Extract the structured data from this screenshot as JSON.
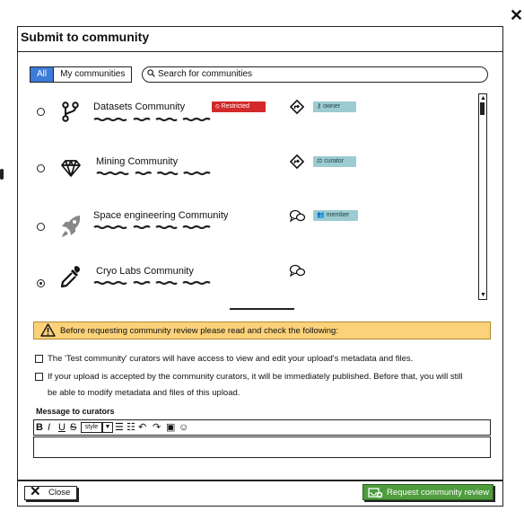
{
  "modal": {
    "title": "Submit to community",
    "close_glyph": "✕"
  },
  "filter": {
    "tabs": [
      {
        "label": "All",
        "active": true
      },
      {
        "label": "My communities",
        "active": false
      }
    ],
    "search_placeholder": "Search for communities"
  },
  "communities": [
    {
      "name": "Datasets Community",
      "logo": "git-branch-icon",
      "selected": false,
      "badge": "Restricted",
      "action_icon": "direction-sign-icon",
      "role": "owner",
      "role_icon": "key-icon"
    },
    {
      "name": "Mining Community",
      "logo": "diamond-icon",
      "selected": false,
      "badge": "",
      "action_icon": "direction-sign-icon",
      "role": "curator",
      "role_icon": "scale-icon"
    },
    {
      "name": "Space engineering Community",
      "logo": "rocket-icon",
      "selected": false,
      "badge": "",
      "action_icon": "chat-bubbles-icon",
      "role": "member",
      "role_icon": "users-icon"
    },
    {
      "name": "Cryo Labs Community",
      "logo": "pipette-icon",
      "selected": true,
      "badge": "",
      "action_icon": "chat-bubbles-icon",
      "role": "",
      "role_icon": ""
    }
  ],
  "warning": {
    "text": "Before requesting community review please read and check the following:"
  },
  "consent": [
    "The 'Test community' curators will have access to view and edit your upload's metadata and files.",
    "If your upload is accepted by the community curators, it will be immediately published. Before that, you will still",
    "be able to modify metadata and files of this upload."
  ],
  "editor": {
    "label": "Message to curators",
    "toolbar": {
      "bold": "B",
      "italic": "I",
      "underline": "U",
      "strike": "S",
      "style": "style"
    }
  },
  "footer": {
    "close_label": "Close",
    "request_label": "Request community review"
  },
  "colors": {
    "accent": "#3d7bd9",
    "restricted": "#d22a2a",
    "role_badge": "#9ccbd1",
    "warning": "#fbd27a",
    "request": "#4e9c3e"
  }
}
